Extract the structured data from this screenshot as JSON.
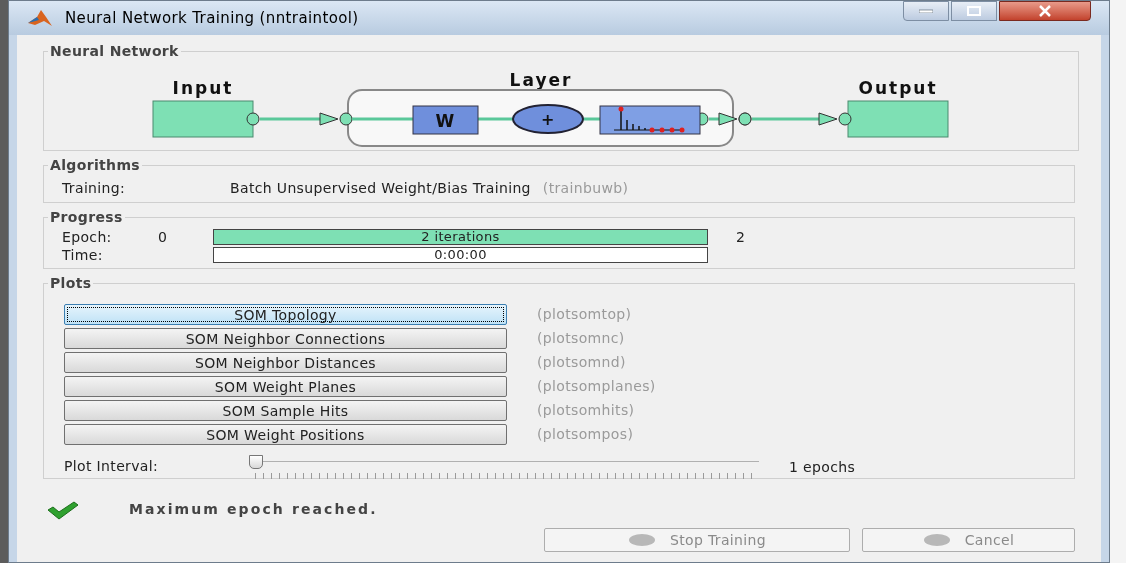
{
  "window": {
    "title": "Neural Network Training (nntraintool)"
  },
  "neural_network": {
    "title": "Neural Network",
    "input_label": "Input",
    "layer_label": "Layer",
    "output_label": "Output",
    "weight_label": "W",
    "sum_label": "+"
  },
  "algorithms": {
    "title": "Algorithms",
    "rows": [
      {
        "label": "Training:",
        "value": "Batch Unsupervised Weight/Bias Training",
        "function": "(trainbuwb)"
      }
    ]
  },
  "progress": {
    "title": "Progress",
    "rows": [
      {
        "kind": "bar",
        "label": "Epoch:",
        "start": "0",
        "text": "2 iterations",
        "level": 1,
        "end": "2"
      },
      {
        "kind": "field",
        "label": "Time:",
        "text": "0:00:00"
      }
    ]
  },
  "plots": {
    "title": "Plots",
    "buttons": [
      {
        "label": "SOM Topology",
        "function": "(plotsomtop)",
        "selected": true
      },
      {
        "label": "SOM Neighbor Connections",
        "function": "(plotsomnc)",
        "selected": false
      },
      {
        "label": "SOM Neighbor Distances",
        "function": "(plotsomnd)",
        "selected": false
      },
      {
        "label": "SOM Weight Planes",
        "function": "(plotsomplanes)",
        "selected": false
      },
      {
        "label": "SOM Sample Hits",
        "function": "(plotsomhits)",
        "selected": false
      },
      {
        "label": "SOM Weight Positions",
        "function": "(plotsompos)",
        "selected": false
      }
    ],
    "interval": {
      "label": "Plot Interval:",
      "level": 0,
      "reading": "1 epochs"
    }
  },
  "status": {
    "message": "Maximum epoch reached."
  },
  "buttons": [
    {
      "label": "Stop Training",
      "disabled": true
    },
    {
      "label": "Cancel",
      "disabled": true
    }
  ]
}
